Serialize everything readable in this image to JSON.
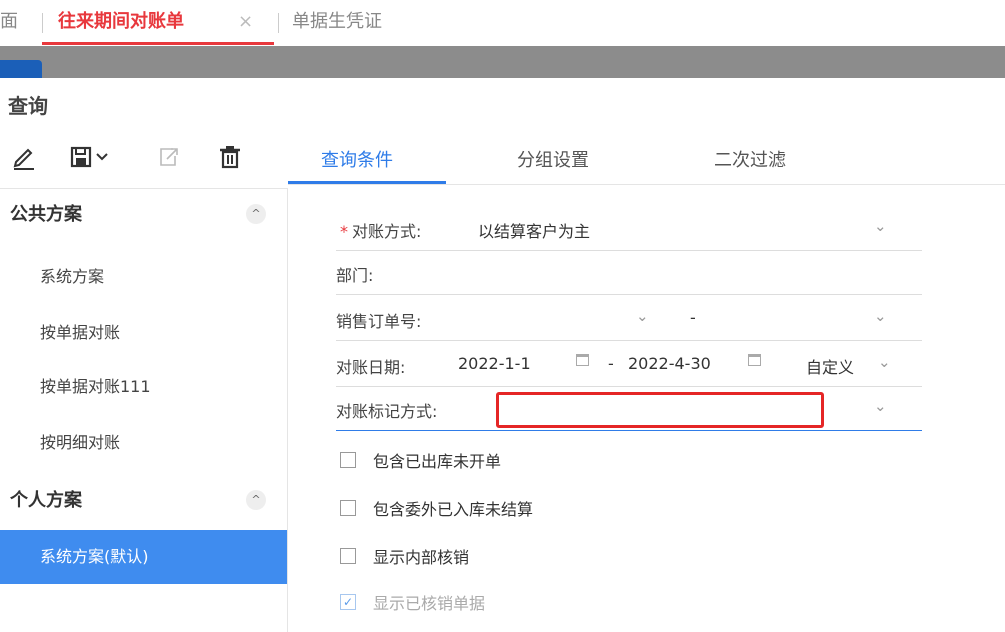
{
  "tabs": {
    "prev_partial": "面",
    "active": "往来期间对账单",
    "close": "×",
    "next": "单据生凭证"
  },
  "dialog": {
    "title": "查询"
  },
  "toolbar": {
    "edit_icon": "pencil-icon",
    "save_icon": "save-icon",
    "save_dropdown": "⌄",
    "export_icon": "export-icon",
    "delete_icon": "trash-icon"
  },
  "sidebar": {
    "public": {
      "label": "公共方案",
      "toggle": "^",
      "items": [
        "系统方案",
        "按单据对账",
        "按单据对账111",
        "按明细对账"
      ]
    },
    "personal": {
      "label": "个人方案",
      "toggle": "^",
      "items": [
        "系统方案(默认)"
      ]
    }
  },
  "query_tabs": [
    "查询条件",
    "分组设置",
    "二次过滤"
  ],
  "form": {
    "reconcile_mode": {
      "label": "对账方式:",
      "value": "以结算客户为主",
      "required": "*"
    },
    "department": {
      "label": "部门:"
    },
    "sales_order": {
      "label": "销售订单号:",
      "sep": "-"
    },
    "reconcile_date": {
      "label": "对账日期:",
      "from": "2022-1-1",
      "sep": "-",
      "to": "2022-4-30",
      "range": "自定义"
    },
    "mark_mode": {
      "label": "对账标记方式:",
      "value": ""
    }
  },
  "checkboxes": [
    {
      "label": "包含已出库未开单",
      "checked": false
    },
    {
      "label": "包含委外已入库未结算",
      "checked": false
    },
    {
      "label": "显示内部核销",
      "checked": false
    },
    {
      "label": "显示已核销单据",
      "checked": true
    }
  ],
  "colors": {
    "accent": "#2f7ce8",
    "active_tab": "#e8383d",
    "sidebar_active": "#3f8cef",
    "highlight": "#e52626"
  }
}
